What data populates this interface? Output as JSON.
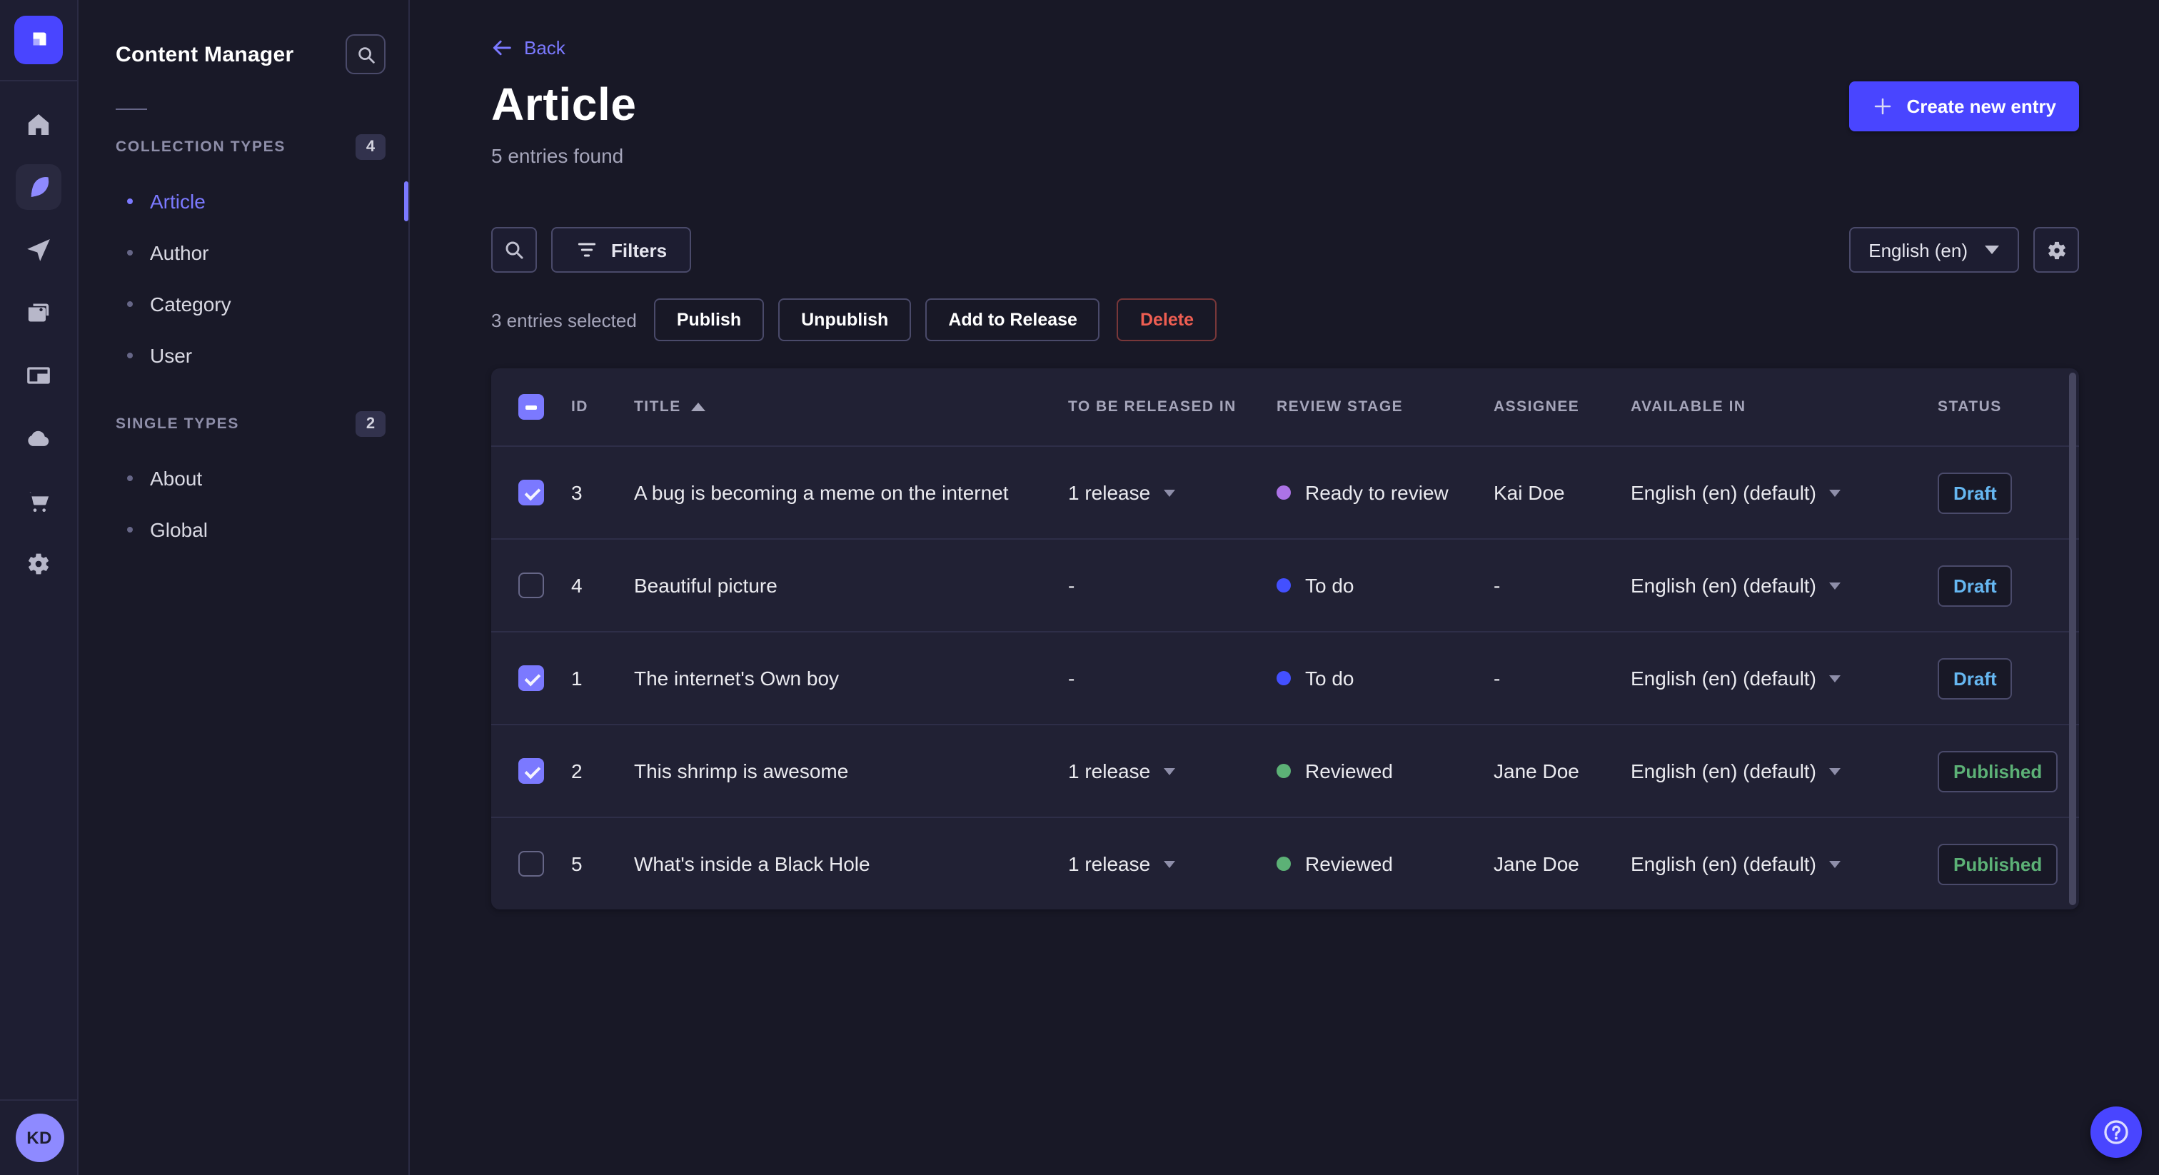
{
  "colors": {
    "primary": "#4945ff",
    "primary_light": "#7b79ff",
    "danger": "#ee5e52",
    "draft": "#66b7f1",
    "published": "#5cb176",
    "card_bg": "#212134",
    "app_bg": "#181826"
  },
  "rail": {
    "logo": "strapi-logo",
    "items": [
      "home",
      "content-manager",
      "releases",
      "media-library",
      "content-type-builder",
      "deploy-cloud",
      "marketplace",
      "settings"
    ],
    "avatar_initials": "KD"
  },
  "subnav": {
    "title": "Content Manager",
    "sections": [
      {
        "label": "COLLECTION TYPES",
        "badge": "4",
        "items": [
          {
            "label": "Article",
            "active": true
          },
          {
            "label": "Author",
            "active": false
          },
          {
            "label": "Category",
            "active": false
          },
          {
            "label": "User",
            "active": false
          }
        ]
      },
      {
        "label": "SINGLE TYPES",
        "badge": "2",
        "items": [
          {
            "label": "About",
            "active": false
          },
          {
            "label": "Global",
            "active": false
          }
        ]
      }
    ]
  },
  "header": {
    "back_label": "Back",
    "title": "Article",
    "subtitle": "5 entries found",
    "create_label": "Create new entry"
  },
  "toolbar": {
    "filters_label": "Filters",
    "locale": "English (en)"
  },
  "selection": {
    "summary": "3 entries selected",
    "publish_label": "Publish",
    "unpublish_label": "Unpublish",
    "add_to_release_label": "Add to Release",
    "delete_label": "Delete"
  },
  "table": {
    "header_checkbox_state": "indeterminate",
    "columns": {
      "id": "ID",
      "title": "TITLE",
      "released": "TO BE RELEASED IN",
      "review": "REVIEW STAGE",
      "assignee": "ASSIGNEE",
      "available": "AVAILABLE IN",
      "status": "STATUS"
    },
    "rows": [
      {
        "selected": true,
        "id": "3",
        "title": "A bug is becoming a meme on the internet",
        "released": "1 release",
        "review_label": "Ready to review",
        "review_color": "#ac73e6",
        "assignee": "Kai Doe",
        "available": "English (en) (default)",
        "status_label": "Draft",
        "status_color": "#66b7f1"
      },
      {
        "selected": false,
        "id": "4",
        "title": "Beautiful picture",
        "released": "-",
        "review_label": "To do",
        "review_color": "#4350ff",
        "assignee": "-",
        "available": "English (en) (default)",
        "status_label": "Draft",
        "status_color": "#66b7f1"
      },
      {
        "selected": true,
        "id": "1",
        "title": "The internet's Own boy",
        "released": "-",
        "review_label": "To do",
        "review_color": "#4350ff",
        "assignee": "-",
        "available": "English (en) (default)",
        "status_label": "Draft",
        "status_color": "#66b7f1"
      },
      {
        "selected": true,
        "id": "2",
        "title": "This shrimp is awesome",
        "released": "1 release",
        "review_label": "Reviewed",
        "review_color": "#5cb176",
        "assignee": "Jane Doe",
        "available": "English (en) (default)",
        "status_label": "Published",
        "status_color": "#5cb176"
      },
      {
        "selected": false,
        "id": "5",
        "title": "What's inside a Black Hole",
        "released": "1 release",
        "review_label": "Reviewed",
        "review_color": "#5cb176",
        "assignee": "Jane Doe",
        "available": "English (en) (default)",
        "status_label": "Published",
        "status_color": "#5cb176"
      }
    ]
  },
  "fab": {
    "icon": "help"
  }
}
